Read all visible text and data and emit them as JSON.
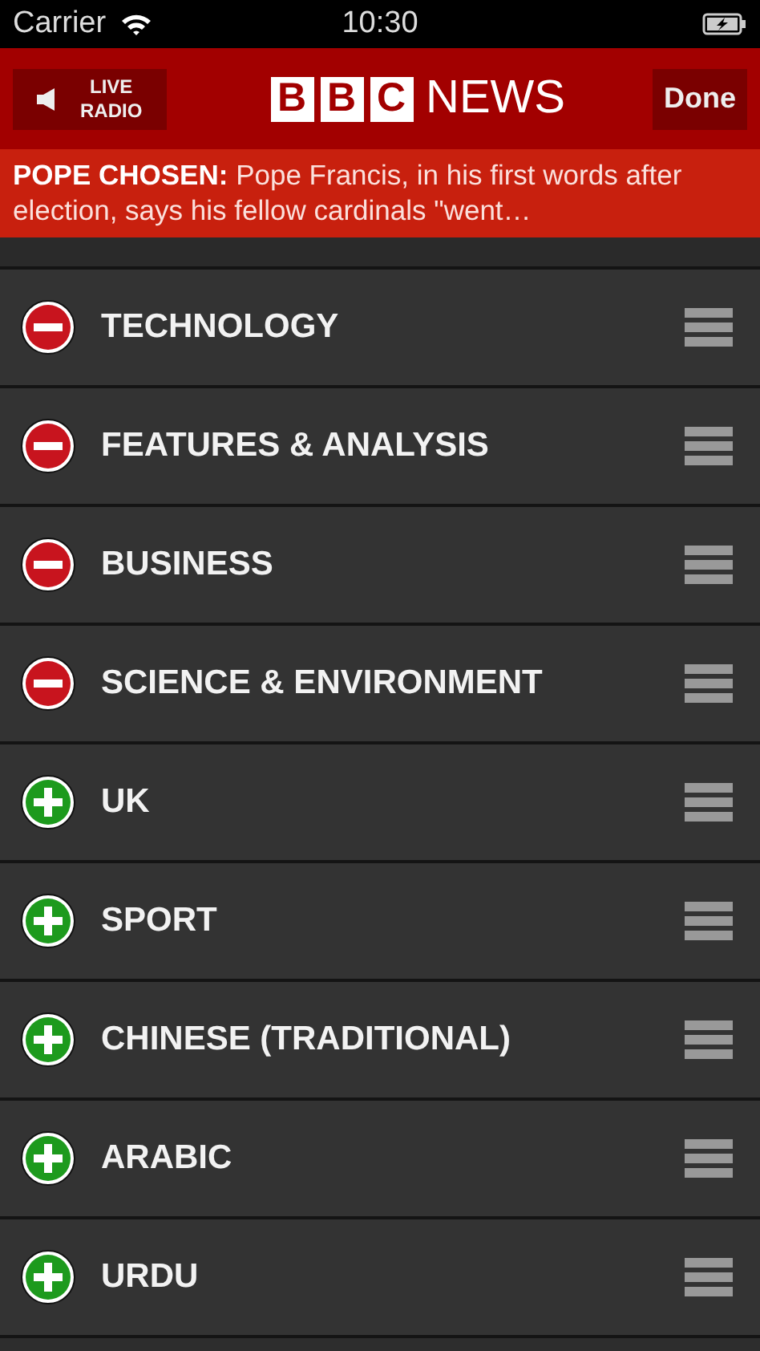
{
  "status_bar": {
    "carrier": "Carrier",
    "time": "10:30"
  },
  "header": {
    "radio_button": {
      "lines": [
        "LIVE",
        "RADIO"
      ],
      "playing": false
    },
    "logo": {
      "blocks": [
        "B",
        "B",
        "C"
      ],
      "word": "NEWS"
    },
    "done_button": "Done"
  },
  "breaking_news": {
    "label": "POPE CHOSEN:",
    "text": "Pope Francis, in his first words after election, says his fellow cardinals \"went…"
  },
  "sections": [
    {
      "label": "TECHNOLOGY",
      "kind": "remove"
    },
    {
      "label": "FEATURES & ANALYSIS",
      "kind": "remove"
    },
    {
      "label": "BUSINESS",
      "kind": "remove"
    },
    {
      "label": "SCIENCE & ENVIRONMENT",
      "kind": "remove"
    },
    {
      "label": "UK",
      "kind": "add"
    },
    {
      "label": "SPORT",
      "kind": "add"
    },
    {
      "label": "CHINESE (TRADITIONAL)",
      "kind": "add"
    },
    {
      "label": "ARABIC",
      "kind": "add"
    },
    {
      "label": "URDU",
      "kind": "add"
    }
  ]
}
